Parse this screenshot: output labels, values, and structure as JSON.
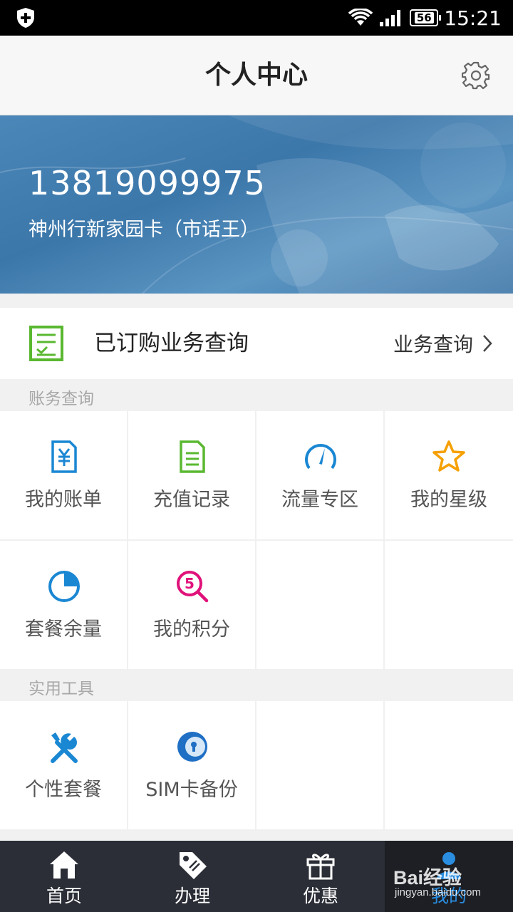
{
  "status_bar": {
    "time": "15:21",
    "battery": "56"
  },
  "header": {
    "title": "个人中心"
  },
  "account": {
    "phone": "13819099975",
    "plan": "神州行新家园卡（市话王）"
  },
  "order": {
    "label": "已订购业务查询",
    "link": "业务查询"
  },
  "sections": {
    "billing": {
      "label": "账务查询",
      "items": [
        {
          "label": "我的账单",
          "icon": "yuan-bill-icon"
        },
        {
          "label": "充值记录",
          "icon": "recharge-record-icon"
        },
        {
          "label": "流量专区",
          "icon": "speedometer-icon"
        },
        {
          "label": "我的星级",
          "icon": "star-icon"
        },
        {
          "label": "套餐余量",
          "icon": "pie-chart-icon"
        },
        {
          "label": "我的积分",
          "icon": "points-search-icon",
          "badge": "5"
        }
      ]
    },
    "tools": {
      "label": "实用工具",
      "items": [
        {
          "label": "个性套餐",
          "icon": "tools-icon"
        },
        {
          "label": "SIM卡备份",
          "icon": "sim-backup-icon"
        }
      ]
    }
  },
  "tabs": [
    {
      "label": "首页",
      "icon": "home-icon"
    },
    {
      "label": "办理",
      "icon": "tag-icon"
    },
    {
      "label": "优惠",
      "icon": "gift-icon"
    },
    {
      "label": "我的",
      "icon": "user-icon",
      "active": true
    }
  ],
  "watermark": {
    "line1": "Bai经验",
    "line2": "jingyan.baidu.com"
  },
  "colors": {
    "accent": "#2a8de0",
    "green": "#5ab830",
    "orange": "#f5a000",
    "magenta": "#e0117a",
    "banner": "#3f7bad"
  }
}
